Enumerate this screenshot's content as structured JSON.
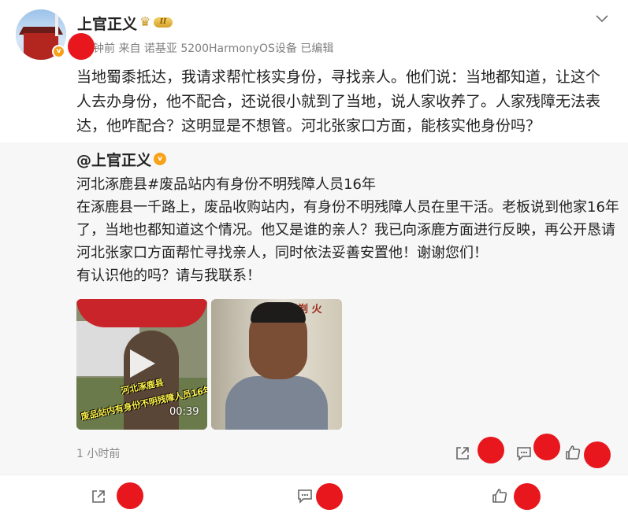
{
  "post": {
    "username": "上官正义",
    "level_badge": "II",
    "meta_text": "分钟前  来自 诺基亚 5200HarmonyOS设备 已编辑",
    "text": "当地蜀黍抵达，我请求帮忙核实身份，寻找亲人。他们说：当地都知道，让这个人去办身份，他不配合，还说很小就到了当地，说人家收养了。人家残障无法表达，他咋配合？这明显是不想管。河北张家口方面，能核实他身份吗？"
  },
  "repost": {
    "author": "@上官正义",
    "lines": [
      "河北涿鹿县#废品站内有身份不明残障人员16年",
      "在涿鹿县一千路上，废品收购站内，有身份不明残障人员在里干活。老板说到他家16年了，当地也都知道这个情况。他又是谁的亲人？我已向涿鹿方面进行反映，再公开恳请河北张家口方面帮忙寻找亲人，同时依法妥善安置他！谢谢您们！",
      "有认识他的吗？请与我联系！"
    ],
    "video_caption_line1": "河北涿鹿县",
    "video_caption_line2": "废品站内有身份不明残障人员16年",
    "video_duration": "00:39",
    "image2_sign": "剃 火",
    "time": "1 小时前"
  },
  "icons": {
    "verified": "v",
    "crown": "♛",
    "chevron": "chevron-down-icon",
    "share": "share-icon",
    "comment": "comment-icon",
    "like": "like-icon"
  },
  "colors": {
    "redaction": "#e8171d",
    "badge_orange": "#f7a21b",
    "repost_bg": "#f7f7f7"
  }
}
